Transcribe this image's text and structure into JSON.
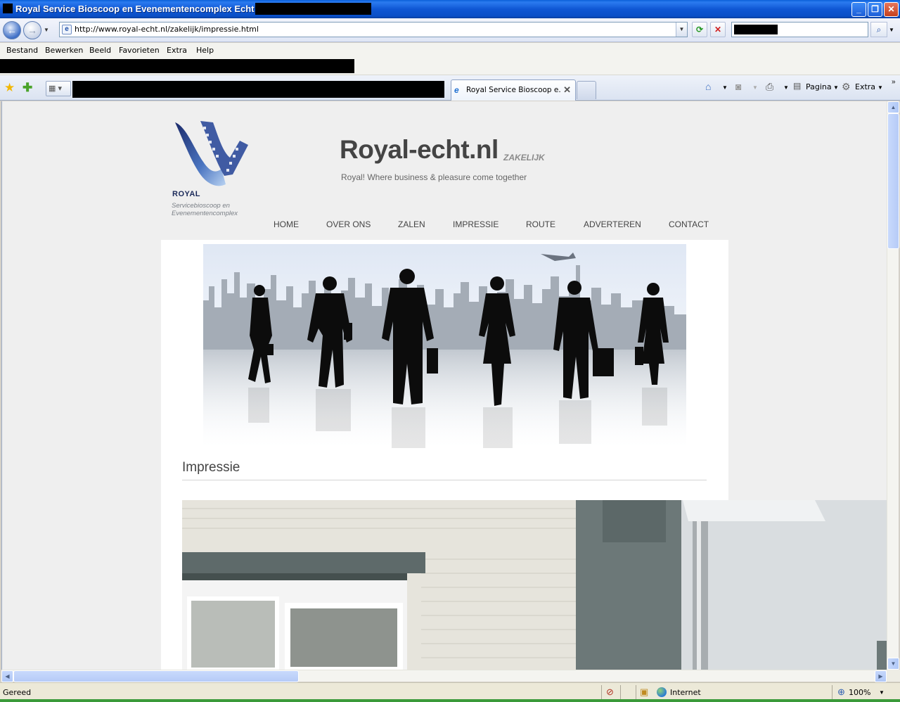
{
  "window": {
    "title": "Royal Service Bioscoop en Evenementencomplex Echt - "
  },
  "address_bar": {
    "url": "http://www.royal-echt.nl/zakelijk/impressie.html"
  },
  "menu": {
    "items": [
      "Bestand",
      "Bewerken",
      "Beeld",
      "Favorieten",
      "Extra",
      "Help"
    ]
  },
  "tabs": {
    "active_label": "Royal Service Bioscoop e..."
  },
  "command_bar": {
    "page_label": "Pagina",
    "tools_label": "Extra"
  },
  "site": {
    "logo_name": "ROYAL",
    "logo_subtitle": "Servicebioscoop en Evenementencomplex",
    "title": "Royal-echt.nl",
    "section_tag": "ZAKELIJK",
    "tagline": "Royal! Where business & pleasure come together",
    "nav": [
      "HOME",
      "OVER ONS",
      "ZALEN",
      "IMPRESSIE",
      "ROUTE",
      "ADVERTEREN",
      "CONTACT"
    ],
    "page_heading": "Impressie"
  },
  "status_bar": {
    "status": "Gereed",
    "zone": "Internet",
    "zoom": "100%"
  },
  "colors": {
    "titlebar": "#0a5fd8",
    "page_background": "#efefef",
    "content_background": "#ffffff"
  }
}
